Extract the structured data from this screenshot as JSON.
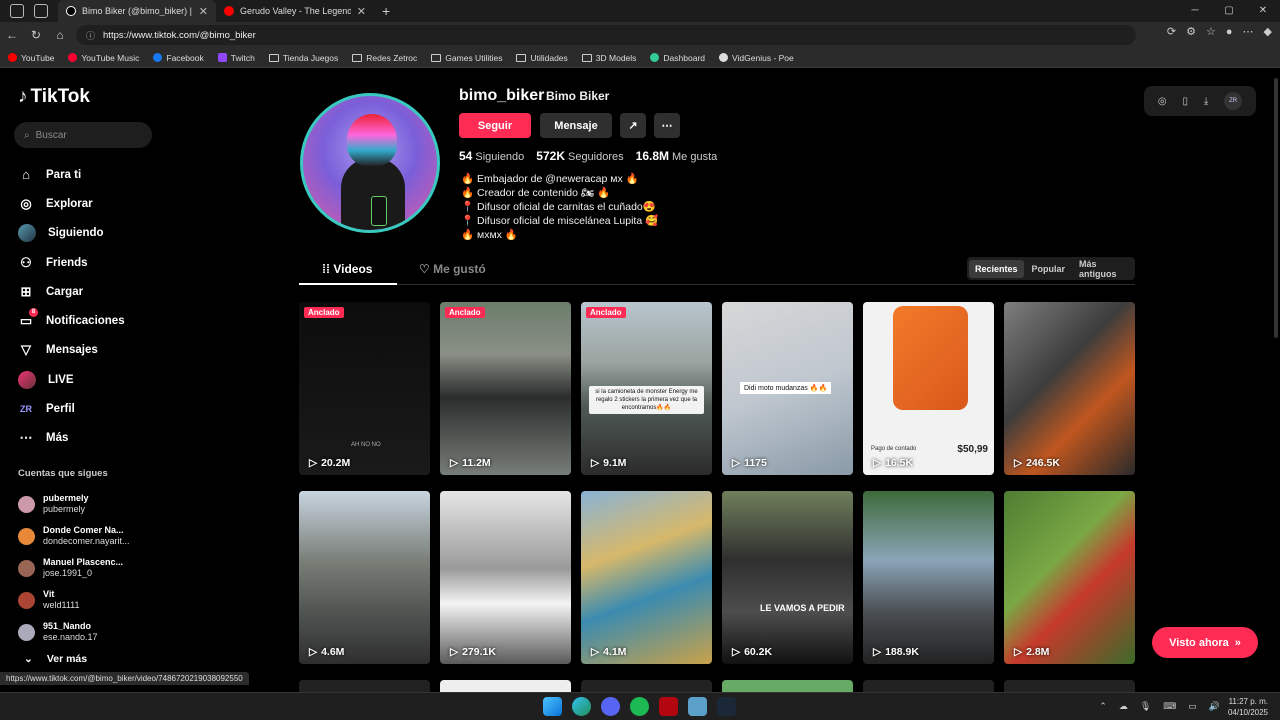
{
  "browser": {
    "tabs": [
      {
        "title": "Bimo Biker (@bimo_biker) | TikTok",
        "color": "#000000",
        "active": true
      },
      {
        "title": "Gerudo Valley - The Legend of Ze",
        "color": "#ff0000",
        "active": false
      }
    ],
    "url": "https://www.tiktok.com/@bimo_biker",
    "status_url": "https://www.tiktok.com/@bimo_biker/video/7486720219038092550",
    "bookmarks": [
      {
        "label": "YouTube",
        "icon": "youtube-icon"
      },
      {
        "label": "YouTube Music",
        "icon": "youtube-music-icon"
      },
      {
        "label": "Facebook",
        "icon": "facebook-icon"
      },
      {
        "label": "Twitch",
        "icon": "twitch-icon"
      },
      {
        "label": "Tienda Juegos",
        "icon": "folder-icon"
      },
      {
        "label": "Redes Zetroc",
        "icon": "folder-icon"
      },
      {
        "label": "Games Utilities",
        "icon": "folder-icon"
      },
      {
        "label": "Utilidades",
        "icon": "folder-icon"
      },
      {
        "label": "3D Models",
        "icon": "folder-icon"
      },
      {
        "label": "Dashboard",
        "icon": "dashboard-icon"
      },
      {
        "label": "VidGenius - Poe",
        "icon": "vidgenius-icon"
      }
    ]
  },
  "sidebar": {
    "logo": "TikTok",
    "search_placeholder": "Buscar",
    "nav": [
      {
        "label": "Para ti",
        "icon": "home-icon"
      },
      {
        "label": "Explorar",
        "icon": "compass-icon"
      },
      {
        "label": "Siguiendo",
        "icon": "following-avatar"
      },
      {
        "label": "Friends",
        "icon": "friends-icon"
      },
      {
        "label": "Cargar",
        "icon": "upload-icon"
      },
      {
        "label": "Notificaciones",
        "icon": "inbox-icon",
        "badge": "8"
      },
      {
        "label": "Mensajes",
        "icon": "messages-icon"
      },
      {
        "label": "LIVE",
        "icon": "live-icon"
      },
      {
        "label": "Perfil",
        "icon": "profile-icon"
      },
      {
        "label": "Más",
        "icon": "more-icon"
      }
    ],
    "following_header": "Cuentas que sigues",
    "following": [
      {
        "name": "pubermely",
        "user": "pubermely",
        "color": "#c9a"
      },
      {
        "name": "Donde Comer Na...",
        "user": "dondecomer.nayarit...",
        "color": "#e8893a"
      },
      {
        "name": "Manuel Plascenc...",
        "user": "jose.1991_0",
        "color": "#996655"
      },
      {
        "name": "Vit",
        "user": "weld1111",
        "color": "#aa4433"
      },
      {
        "name": "951_Nando",
        "user": "ese.nando.17",
        "color": "#aab"
      }
    ],
    "see_more": "Ver más"
  },
  "profile": {
    "username": "bimo_biker",
    "display_name": "Bimo Biker",
    "follow_label": "Seguir",
    "message_label": "Mensaje",
    "following_count": "54",
    "following_label": "Siguiendo",
    "followers_count": "572K",
    "followers_label": "Seguidores",
    "likes_count": "16.8M",
    "likes_label": "Me gusta",
    "bio": [
      "🔥 Embajador de @neweracap мх 🔥",
      "🔥 Creador de contenido 🏍 🔥",
      "📍 Difusor oficial de carnitas el cuñado😍",
      "📍 Difusor oficial de miscelánea Lupita 🥰",
      "🔥 мхмх 🔥"
    ]
  },
  "content_tabs": {
    "videos": "Videos",
    "liked": "Me gustó"
  },
  "sort": {
    "options": [
      "Recientes",
      "Popular",
      "Más antiguos"
    ],
    "selected": "Recientes"
  },
  "videos": [
    {
      "views": "20.2M",
      "pinned": "Anclado"
    },
    {
      "views": "11.2M",
      "pinned": "Anclado"
    },
    {
      "views": "9.1M",
      "pinned": "Anclado",
      "caption": "si la camioneta de monster Energy me regalo 2 stickers la primera vez que la encontramos🔥🔥"
    },
    {
      "views": "1175",
      "caption": "Didi moto mudanzas 🔥🔥"
    },
    {
      "views": "16.5K",
      "price_label": "Pago de contado",
      "price": "$50,99"
    },
    {
      "views": "246.5K"
    },
    {
      "views": "4.6M"
    },
    {
      "views": "279.1K"
    },
    {
      "views": "4.1M"
    },
    {
      "views": "60.2K",
      "caption": "LE VAMOS A PEDIR"
    },
    {
      "views": "188.9K"
    },
    {
      "views": "2.8M"
    }
  ],
  "first_video_overlay": "AH NO NO",
  "watched_button": "Visto ahora",
  "taskbar": {
    "time": "11:27 p. m.",
    "date": "04/10/2025"
  },
  "colors": {
    "accent": "#fe2c55",
    "avatar_ring": "#39c9c0"
  }
}
